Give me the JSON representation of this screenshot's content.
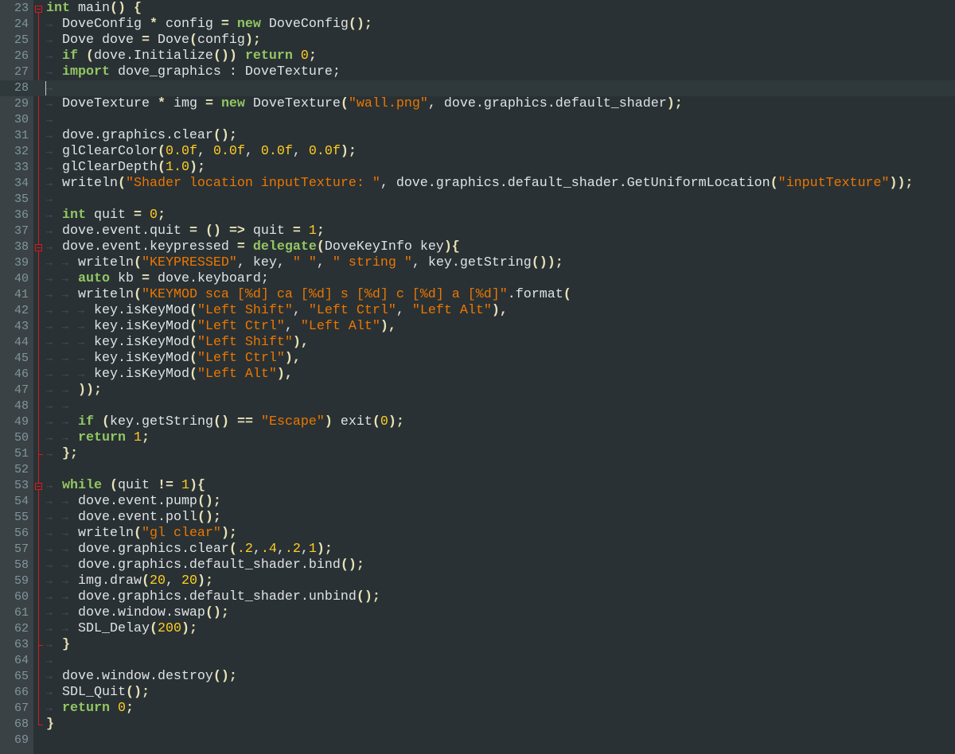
{
  "editor": {
    "current_line": 28,
    "fold_starts": [
      23,
      38,
      53
    ],
    "fold_ends": [
      51,
      63,
      68
    ],
    "colors": {
      "keyword": "#93c763",
      "string": "#ec7600",
      "number": "#ffcd22",
      "operator": "#e8e2b7",
      "text": "#e0e2e4",
      "fold": "#d81a1a"
    },
    "lines": [
      {
        "n": "23",
        "tabs": 0,
        "tokens": [
          [
            "k",
            "int"
          ],
          [
            "t",
            " main"
          ],
          [
            "o",
            "()"
          ],
          [
            "t",
            " "
          ],
          [
            "o",
            "{"
          ]
        ]
      },
      {
        "n": "24",
        "tabs": 1,
        "tokens": [
          [
            "t",
            "DoveConfig "
          ],
          [
            "o",
            "*"
          ],
          [
            "t",
            " config "
          ],
          [
            "o",
            "="
          ],
          [
            "t",
            " "
          ],
          [
            "k",
            "new"
          ],
          [
            "t",
            " DoveConfig"
          ],
          [
            "o",
            "();"
          ]
        ]
      },
      {
        "n": "25",
        "tabs": 1,
        "tokens": [
          [
            "t",
            "Dove dove "
          ],
          [
            "o",
            "="
          ],
          [
            "t",
            " Dove"
          ],
          [
            "o",
            "("
          ],
          [
            "t",
            "config"
          ],
          [
            "o",
            ");"
          ]
        ]
      },
      {
        "n": "26",
        "tabs": 1,
        "tokens": [
          [
            "k",
            "if"
          ],
          [
            "t",
            " "
          ],
          [
            "o",
            "("
          ],
          [
            "t",
            "dove.Initialize"
          ],
          [
            "o",
            "())"
          ],
          [
            "t",
            " "
          ],
          [
            "k",
            "return"
          ],
          [
            "t",
            " "
          ],
          [
            "n",
            "0"
          ],
          [
            "o",
            ";"
          ]
        ]
      },
      {
        "n": "27",
        "tabs": 1,
        "tokens": [
          [
            "k",
            "import"
          ],
          [
            "t",
            " dove_graphics : DoveTexture;"
          ]
        ]
      },
      {
        "n": "28",
        "tabs": 1,
        "tokens": []
      },
      {
        "n": "29",
        "tabs": 1,
        "tokens": [
          [
            "t",
            "DoveTexture "
          ],
          [
            "o",
            "*"
          ],
          [
            "t",
            " img "
          ],
          [
            "o",
            "="
          ],
          [
            "t",
            " "
          ],
          [
            "k",
            "new"
          ],
          [
            "t",
            " DoveTexture"
          ],
          [
            "o",
            "("
          ],
          [
            "s",
            "\"wall.png\""
          ],
          [
            "t",
            ", dove.graphics.default_shader"
          ],
          [
            "o",
            ");"
          ]
        ]
      },
      {
        "n": "30",
        "tabs": 1,
        "tokens": []
      },
      {
        "n": "31",
        "tabs": 1,
        "tokens": [
          [
            "t",
            "dove.graphics.clear"
          ],
          [
            "o",
            "();"
          ]
        ]
      },
      {
        "n": "32",
        "tabs": 1,
        "tokens": [
          [
            "t",
            "glClearColor"
          ],
          [
            "o",
            "("
          ],
          [
            "n",
            "0.0f"
          ],
          [
            "t",
            ", "
          ],
          [
            "n",
            "0.0f"
          ],
          [
            "t",
            ", "
          ],
          [
            "n",
            "0.0f"
          ],
          [
            "t",
            ", "
          ],
          [
            "n",
            "0.0f"
          ],
          [
            "o",
            ");"
          ]
        ]
      },
      {
        "n": "33",
        "tabs": 1,
        "tokens": [
          [
            "t",
            "glClearDepth"
          ],
          [
            "o",
            "("
          ],
          [
            "n",
            "1.0"
          ],
          [
            "o",
            ");"
          ]
        ]
      },
      {
        "n": "34",
        "tabs": 1,
        "tokens": [
          [
            "t",
            "writeln"
          ],
          [
            "o",
            "("
          ],
          [
            "s",
            "\"Shader location inputTexture: \""
          ],
          [
            "t",
            ", dove.graphics.default_shader.GetUniformLocation"
          ],
          [
            "o",
            "("
          ],
          [
            "s",
            "\"inputTexture\""
          ],
          [
            "o",
            "));"
          ]
        ]
      },
      {
        "n": "35",
        "tabs": 1,
        "tokens": []
      },
      {
        "n": "36",
        "tabs": 1,
        "tokens": [
          [
            "k",
            "int"
          ],
          [
            "t",
            " quit "
          ],
          [
            "o",
            "="
          ],
          [
            "t",
            " "
          ],
          [
            "n",
            "0"
          ],
          [
            "o",
            ";"
          ]
        ]
      },
      {
        "n": "37",
        "tabs": 1,
        "tokens": [
          [
            "t",
            "dove.event.quit "
          ],
          [
            "o",
            "="
          ],
          [
            "t",
            " "
          ],
          [
            "o",
            "()"
          ],
          [
            "t",
            " "
          ],
          [
            "o",
            "=>"
          ],
          [
            "t",
            " quit "
          ],
          [
            "o",
            "="
          ],
          [
            "t",
            " "
          ],
          [
            "n",
            "1"
          ],
          [
            "o",
            ";"
          ]
        ]
      },
      {
        "n": "38",
        "tabs": 1,
        "tokens": [
          [
            "t",
            "dove.event.keypressed "
          ],
          [
            "o",
            "="
          ],
          [
            "t",
            " "
          ],
          [
            "k",
            "delegate"
          ],
          [
            "o",
            "("
          ],
          [
            "t",
            "DoveKeyInfo key"
          ],
          [
            "o",
            "){"
          ]
        ]
      },
      {
        "n": "39",
        "tabs": 2,
        "tokens": [
          [
            "t",
            "writeln"
          ],
          [
            "o",
            "("
          ],
          [
            "s",
            "\"KEYPRESSED\""
          ],
          [
            "t",
            ", key, "
          ],
          [
            "s",
            "\" \""
          ],
          [
            "t",
            ", "
          ],
          [
            "s",
            "\" string \""
          ],
          [
            "t",
            ", key.getString"
          ],
          [
            "o",
            "());"
          ]
        ]
      },
      {
        "n": "40",
        "tabs": 2,
        "tokens": [
          [
            "k",
            "auto"
          ],
          [
            "t",
            " kb "
          ],
          [
            "o",
            "="
          ],
          [
            "t",
            " dove.keyboard;"
          ]
        ]
      },
      {
        "n": "41",
        "tabs": 2,
        "tokens": [
          [
            "t",
            "writeln"
          ],
          [
            "o",
            "("
          ],
          [
            "s",
            "\"KEYMOD sca [%d] ca [%d] s [%d] c [%d] a [%d]\""
          ],
          [
            "t",
            ".format"
          ],
          [
            "o",
            "("
          ]
        ]
      },
      {
        "n": "42",
        "tabs": 3,
        "tokens": [
          [
            "t",
            "key.isKeyMod"
          ],
          [
            "o",
            "("
          ],
          [
            "s",
            "\"Left Shift\""
          ],
          [
            "t",
            ", "
          ],
          [
            "s",
            "\"Left Ctrl\""
          ],
          [
            "t",
            ", "
          ],
          [
            "s",
            "\"Left Alt\""
          ],
          [
            "o",
            "),"
          ]
        ]
      },
      {
        "n": "43",
        "tabs": 3,
        "tokens": [
          [
            "t",
            "key.isKeyMod"
          ],
          [
            "o",
            "("
          ],
          [
            "s",
            "\"Left Ctrl\""
          ],
          [
            "t",
            ", "
          ],
          [
            "s",
            "\"Left Alt\""
          ],
          [
            "o",
            "),"
          ]
        ]
      },
      {
        "n": "44",
        "tabs": 3,
        "tokens": [
          [
            "t",
            "key.isKeyMod"
          ],
          [
            "o",
            "("
          ],
          [
            "s",
            "\"Left Shift\""
          ],
          [
            "o",
            "),"
          ]
        ]
      },
      {
        "n": "45",
        "tabs": 3,
        "tokens": [
          [
            "t",
            "key.isKeyMod"
          ],
          [
            "o",
            "("
          ],
          [
            "s",
            "\"Left Ctrl\""
          ],
          [
            "o",
            "),"
          ]
        ]
      },
      {
        "n": "46",
        "tabs": 3,
        "tokens": [
          [
            "t",
            "key.isKeyMod"
          ],
          [
            "o",
            "("
          ],
          [
            "s",
            "\"Left Alt\""
          ],
          [
            "o",
            "),"
          ]
        ]
      },
      {
        "n": "47",
        "tabs": 2,
        "tokens": [
          [
            "o",
            "));"
          ]
        ]
      },
      {
        "n": "48",
        "tabs": 2,
        "tokens": []
      },
      {
        "n": "49",
        "tabs": 2,
        "tokens": [
          [
            "k",
            "if"
          ],
          [
            "t",
            " "
          ],
          [
            "o",
            "("
          ],
          [
            "t",
            "key.getString"
          ],
          [
            "o",
            "()"
          ],
          [
            "t",
            " "
          ],
          [
            "o",
            "=="
          ],
          [
            "t",
            " "
          ],
          [
            "s",
            "\"Escape\""
          ],
          [
            "o",
            ")"
          ],
          [
            "t",
            " exit"
          ],
          [
            "o",
            "("
          ],
          [
            "n",
            "0"
          ],
          [
            "o",
            ");"
          ]
        ]
      },
      {
        "n": "50",
        "tabs": 2,
        "tokens": [
          [
            "k",
            "return"
          ],
          [
            "t",
            " "
          ],
          [
            "n",
            "1"
          ],
          [
            "o",
            ";"
          ]
        ]
      },
      {
        "n": "51",
        "tabs": 1,
        "tokens": [
          [
            "o",
            "};"
          ]
        ]
      },
      {
        "n": "52",
        "tabs": 0,
        "tokens": []
      },
      {
        "n": "53",
        "tabs": 1,
        "tokens": [
          [
            "k",
            "while"
          ],
          [
            "t",
            " "
          ],
          [
            "o",
            "("
          ],
          [
            "t",
            "quit "
          ],
          [
            "o",
            "!="
          ],
          [
            "t",
            " "
          ],
          [
            "n",
            "1"
          ],
          [
            "o",
            "){"
          ]
        ]
      },
      {
        "n": "54",
        "tabs": 2,
        "tokens": [
          [
            "t",
            "dove.event.pump"
          ],
          [
            "o",
            "();"
          ]
        ]
      },
      {
        "n": "55",
        "tabs": 2,
        "tokens": [
          [
            "t",
            "dove.event.poll"
          ],
          [
            "o",
            "();"
          ]
        ]
      },
      {
        "n": "56",
        "tabs": 2,
        "tokens": [
          [
            "t",
            "writeln"
          ],
          [
            "o",
            "("
          ],
          [
            "s",
            "\"gl clear\""
          ],
          [
            "o",
            ");"
          ]
        ]
      },
      {
        "n": "57",
        "tabs": 2,
        "tokens": [
          [
            "t",
            "dove.graphics.clear"
          ],
          [
            "o",
            "("
          ],
          [
            "n",
            ".2"
          ],
          [
            "t",
            ","
          ],
          [
            "n",
            ".4"
          ],
          [
            "t",
            ","
          ],
          [
            "n",
            ".2"
          ],
          [
            "t",
            ","
          ],
          [
            "n",
            "1"
          ],
          [
            "o",
            ");"
          ]
        ]
      },
      {
        "n": "58",
        "tabs": 2,
        "tokens": [
          [
            "t",
            "dove.graphics.default_shader.bind"
          ],
          [
            "o",
            "();"
          ]
        ]
      },
      {
        "n": "59",
        "tabs": 2,
        "tokens": [
          [
            "t",
            "img.draw"
          ],
          [
            "o",
            "("
          ],
          [
            "n",
            "20"
          ],
          [
            "t",
            ", "
          ],
          [
            "n",
            "20"
          ],
          [
            "o",
            ");"
          ]
        ]
      },
      {
        "n": "60",
        "tabs": 2,
        "tokens": [
          [
            "t",
            "dove.graphics.default_shader.unbind"
          ],
          [
            "o",
            "();"
          ]
        ]
      },
      {
        "n": "61",
        "tabs": 2,
        "tokens": [
          [
            "t",
            "dove.window.swap"
          ],
          [
            "o",
            "();"
          ]
        ]
      },
      {
        "n": "62",
        "tabs": 2,
        "tokens": [
          [
            "t",
            "SDL_Delay"
          ],
          [
            "o",
            "("
          ],
          [
            "n",
            "200"
          ],
          [
            "o",
            ");"
          ]
        ]
      },
      {
        "n": "63",
        "tabs": 1,
        "tokens": [
          [
            "o",
            "}"
          ]
        ]
      },
      {
        "n": "64",
        "tabs": 1,
        "tokens": []
      },
      {
        "n": "65",
        "tabs": 1,
        "tokens": [
          [
            "t",
            "dove.window.destroy"
          ],
          [
            "o",
            "();"
          ]
        ]
      },
      {
        "n": "66",
        "tabs": 1,
        "tokens": [
          [
            "t",
            "SDL_Quit"
          ],
          [
            "o",
            "();"
          ]
        ]
      },
      {
        "n": "67",
        "tabs": 1,
        "tokens": [
          [
            "k",
            "return"
          ],
          [
            "t",
            " "
          ],
          [
            "n",
            "0"
          ],
          [
            "o",
            ";"
          ]
        ]
      },
      {
        "n": "68",
        "tabs": 0,
        "tokens": [
          [
            "o",
            "}"
          ]
        ]
      },
      {
        "n": "69",
        "tabs": 0,
        "tokens": []
      }
    ]
  }
}
